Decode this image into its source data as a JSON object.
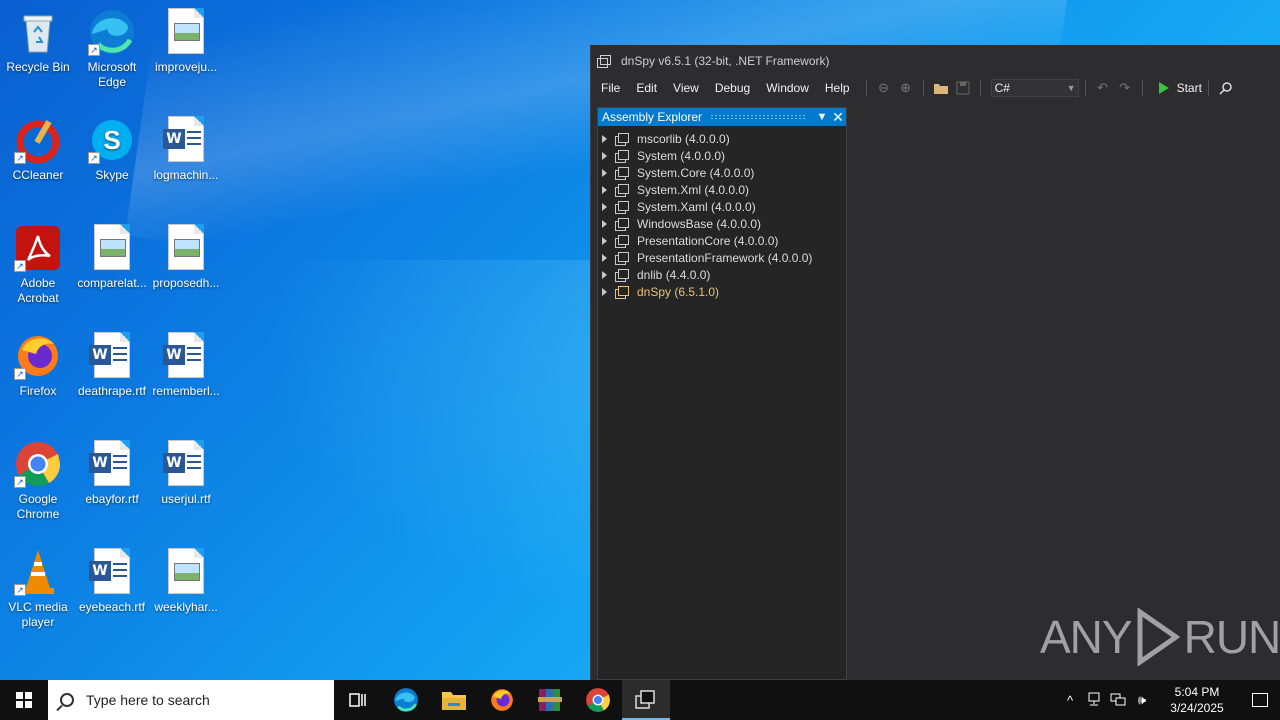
{
  "desktop": {
    "icons": [
      {
        "label": "Recycle Bin"
      },
      {
        "label": "Microsoft Edge"
      },
      {
        "label": "improveju..."
      },
      {
        "label": "CCleaner"
      },
      {
        "label": "Skype"
      },
      {
        "label": "logmachin..."
      },
      {
        "label": "Adobe Acrobat"
      },
      {
        "label": "comparelat..."
      },
      {
        "label": "proposedh..."
      },
      {
        "label": "Firefox"
      },
      {
        "label": "deathrape.rtf"
      },
      {
        "label": "rememberl..."
      },
      {
        "label": "Google Chrome"
      },
      {
        "label": "ebayfor.rtf"
      },
      {
        "label": "userjul.rtf"
      },
      {
        "label": "VLC media player"
      },
      {
        "label": "eyebeach.rtf"
      },
      {
        "label": "weeklyhar..."
      }
    ]
  },
  "window": {
    "title": "dnSpy v6.5.1 (32-bit, .NET Framework)",
    "menu": [
      "File",
      "Edit",
      "View",
      "Debug",
      "Window",
      "Help"
    ],
    "language": "C#",
    "start_label": "Start"
  },
  "assembly_explorer": {
    "title": "Assembly Explorer",
    "items": [
      {
        "label": "mscorlib (4.0.0.0)"
      },
      {
        "label": "System (4.0.0.0)"
      },
      {
        "label": "System.Core (4.0.0.0)"
      },
      {
        "label": "System.Xml (4.0.0.0)"
      },
      {
        "label": "System.Xaml (4.0.0.0)"
      },
      {
        "label": "WindowsBase (4.0.0.0)"
      },
      {
        "label": "PresentationCore (4.0.0.0)"
      },
      {
        "label": "PresentationFramework (4.0.0.0)"
      },
      {
        "label": "dnlib (4.4.0.0)"
      },
      {
        "label": "dnSpy (6.5.1.0)"
      }
    ]
  },
  "watermark": {
    "left": "ANY",
    "right": "RUN"
  },
  "taskbar": {
    "search_placeholder": "Type here to search",
    "time": "5:04 PM",
    "date": "3/24/2025"
  }
}
